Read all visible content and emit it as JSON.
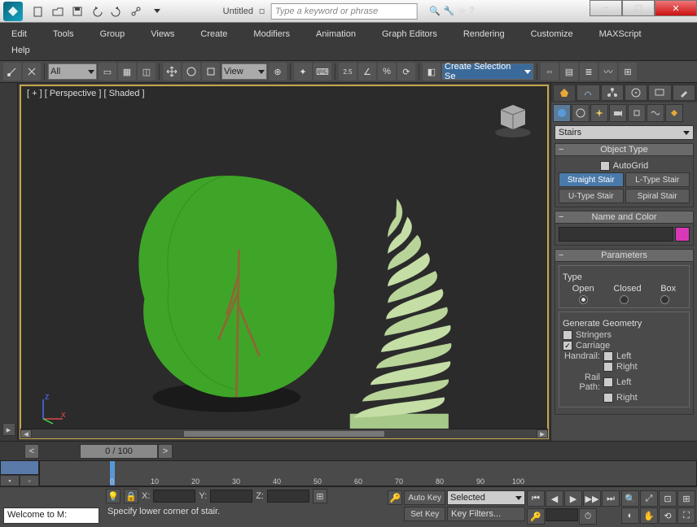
{
  "window": {
    "title": "Untitled"
  },
  "search": {
    "placeholder": "Type a keyword or phrase"
  },
  "menu": {
    "row1": [
      "Edit",
      "Tools",
      "Group",
      "Views",
      "Create",
      "Modifiers",
      "Animation",
      "Graph Editors",
      "Rendering",
      "Customize",
      "MAXScript"
    ],
    "row2": [
      "Help"
    ]
  },
  "toolbar": {
    "filter_label": "All",
    "coord_label": "View",
    "selset_label": "Create Selection Se"
  },
  "viewport": {
    "label": "[ + ] [ Perspective ] [ Shaded ]"
  },
  "cmdpanel": {
    "category": "Stairs",
    "object_type_title": "Object Type",
    "autogrid_label": "AutoGrid",
    "buttons": [
      "Straight Stair",
      "L-Type Stair",
      "U-Type Stair",
      "Spiral Stair"
    ],
    "name_color_title": "Name and Color",
    "params_title": "Parameters",
    "type_label": "Type",
    "type_opts": [
      "Open",
      "Closed",
      "Box"
    ],
    "gengeom_label": "Generate Geometry",
    "stringers_label": "Stringers",
    "carriage_label": "Carriage",
    "handrail_label": "Handrail:",
    "railpath_label": "Rail Path:",
    "left_label": "Left",
    "right_label": "Right"
  },
  "timeslider": {
    "pos": "0 / 100"
  },
  "ruler": {
    "ticks": [
      "0",
      "10",
      "20",
      "30",
      "40",
      "50",
      "60",
      "70",
      "80",
      "90",
      "100"
    ]
  },
  "status": {
    "welcome": "Welcome to M:",
    "prompt": "Specify lower corner of stair.",
    "x": "X:",
    "y": "Y:",
    "z": "Z:",
    "autokey": "Auto Key",
    "setkey": "Set Key",
    "selected": "Selected",
    "keyfilters": "Key Filters..."
  }
}
